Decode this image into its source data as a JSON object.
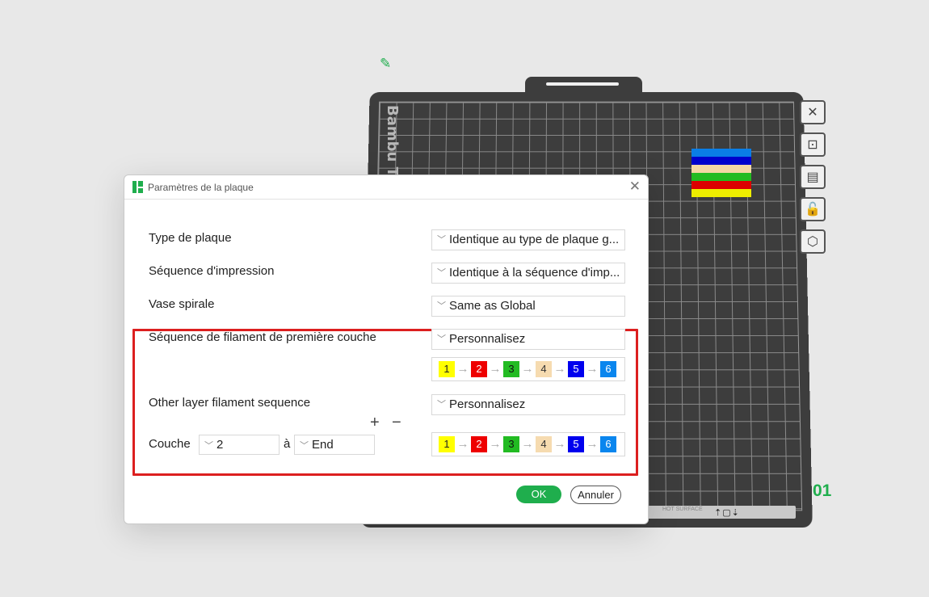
{
  "plate": {
    "brand_text": "Bambu Te",
    "number": "01",
    "bottom_text": "HOT SURFACE",
    "object_stripes": [
      "#0a7ee6",
      "#0000cc",
      "#f4d7a5",
      "#22bb22",
      "#dd0000",
      "#eeee00"
    ]
  },
  "toolbar": {
    "items": [
      {
        "name": "close-plate",
        "glyph": "✕"
      },
      {
        "name": "auto-arrange",
        "glyph": "⊡"
      },
      {
        "name": "layout",
        "glyph": "▤"
      },
      {
        "name": "lock",
        "glyph": "🔓"
      },
      {
        "name": "settings",
        "glyph": "⬡"
      }
    ]
  },
  "dialog": {
    "title": "Paramètres de la plaque",
    "close_glyph": "✕",
    "rows": {
      "plate_type": {
        "label": "Type de plaque",
        "value": "Identique au type de plaque g..."
      },
      "print_sequence": {
        "label": "Séquence d'impression",
        "value": "Identique à la séquence d'imp..."
      },
      "spiral_vase": {
        "label": "Vase spirale",
        "value": "Same as Global"
      },
      "first_layer_seq": {
        "label": "Séquence de filament de première couche",
        "value": "Personnalisez"
      },
      "other_layer_seq": {
        "label": "Other layer filament sequence",
        "value": "Personnalisez"
      }
    },
    "layer": {
      "label": "Couche",
      "from": "2",
      "to_label": "à",
      "to": "End"
    },
    "plus": "+",
    "minus": "−",
    "arrow": "→",
    "filaments": [
      {
        "n": "1",
        "color": "#ffff00",
        "text": "#222222"
      },
      {
        "n": "2",
        "color": "#ee0000",
        "text": "#ffffff"
      },
      {
        "n": "3",
        "color": "#22bb22",
        "text": "#111111"
      },
      {
        "n": "4",
        "color": "#f6dbb0",
        "text": "#333333"
      },
      {
        "n": "5",
        "color": "#0000ee",
        "text": "#ffffff"
      },
      {
        "n": "6",
        "color": "#0a86ee",
        "text": "#ffffff"
      }
    ],
    "ok_label": "OK",
    "cancel_label": "Annuler",
    "colors": {
      "accent": "#1fae4d",
      "highlight": "#dc1f1f"
    }
  }
}
